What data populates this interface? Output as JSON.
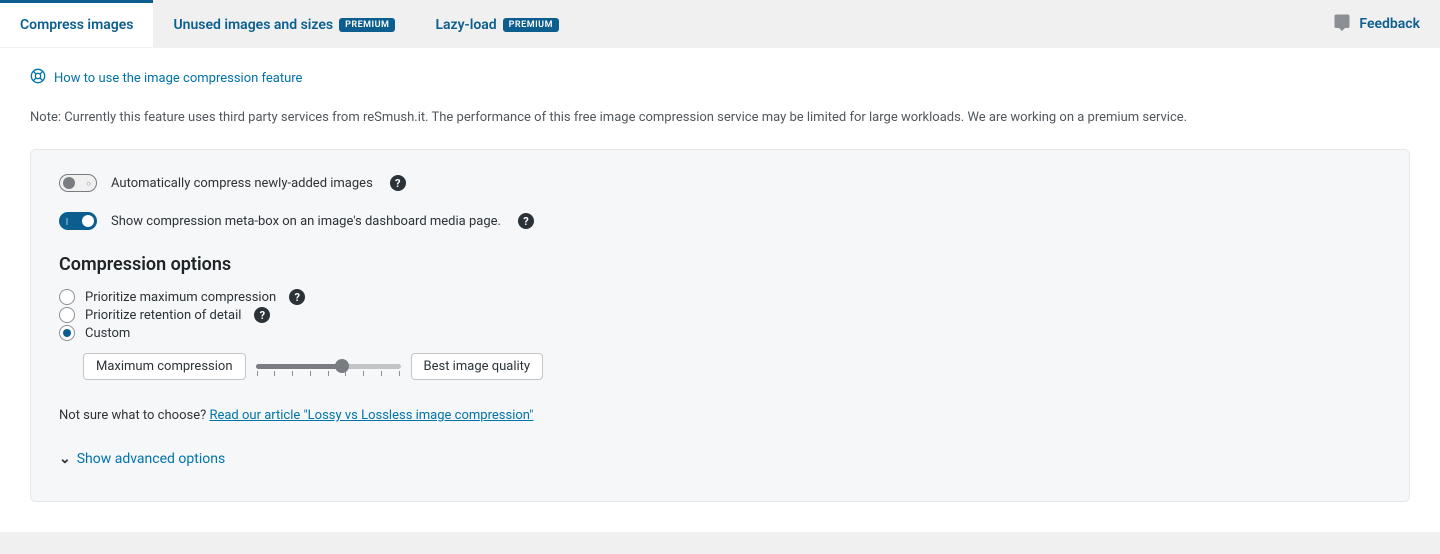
{
  "tabs": {
    "compress": "Compress images",
    "unused": "Unused images and sizes",
    "lazyload": "Lazy-load",
    "premium_badge": "PREMIUM"
  },
  "feedback": "Feedback",
  "help_link": "How to use the image compression feature",
  "note": "Note: Currently this feature uses third party services from reSmush.it. The performance of this free image compression service may be limited for large workloads. We are working on a premium service.",
  "toggles": {
    "auto_compress": "Automatically compress newly-added images",
    "meta_box": "Show compression meta-box on an image's dashboard media page."
  },
  "section_title": "Compression options",
  "radios": {
    "max_compression": "Prioritize maximum compression",
    "retention": "Prioritize retention of detail",
    "custom": "Custom"
  },
  "slider": {
    "left_label": "Maximum compression",
    "right_label": "Best image quality"
  },
  "article": {
    "prefix": "Not sure what to choose? ",
    "link": "Read our article \"Lossy vs Lossless image compression\""
  },
  "advanced": "Show advanced options"
}
